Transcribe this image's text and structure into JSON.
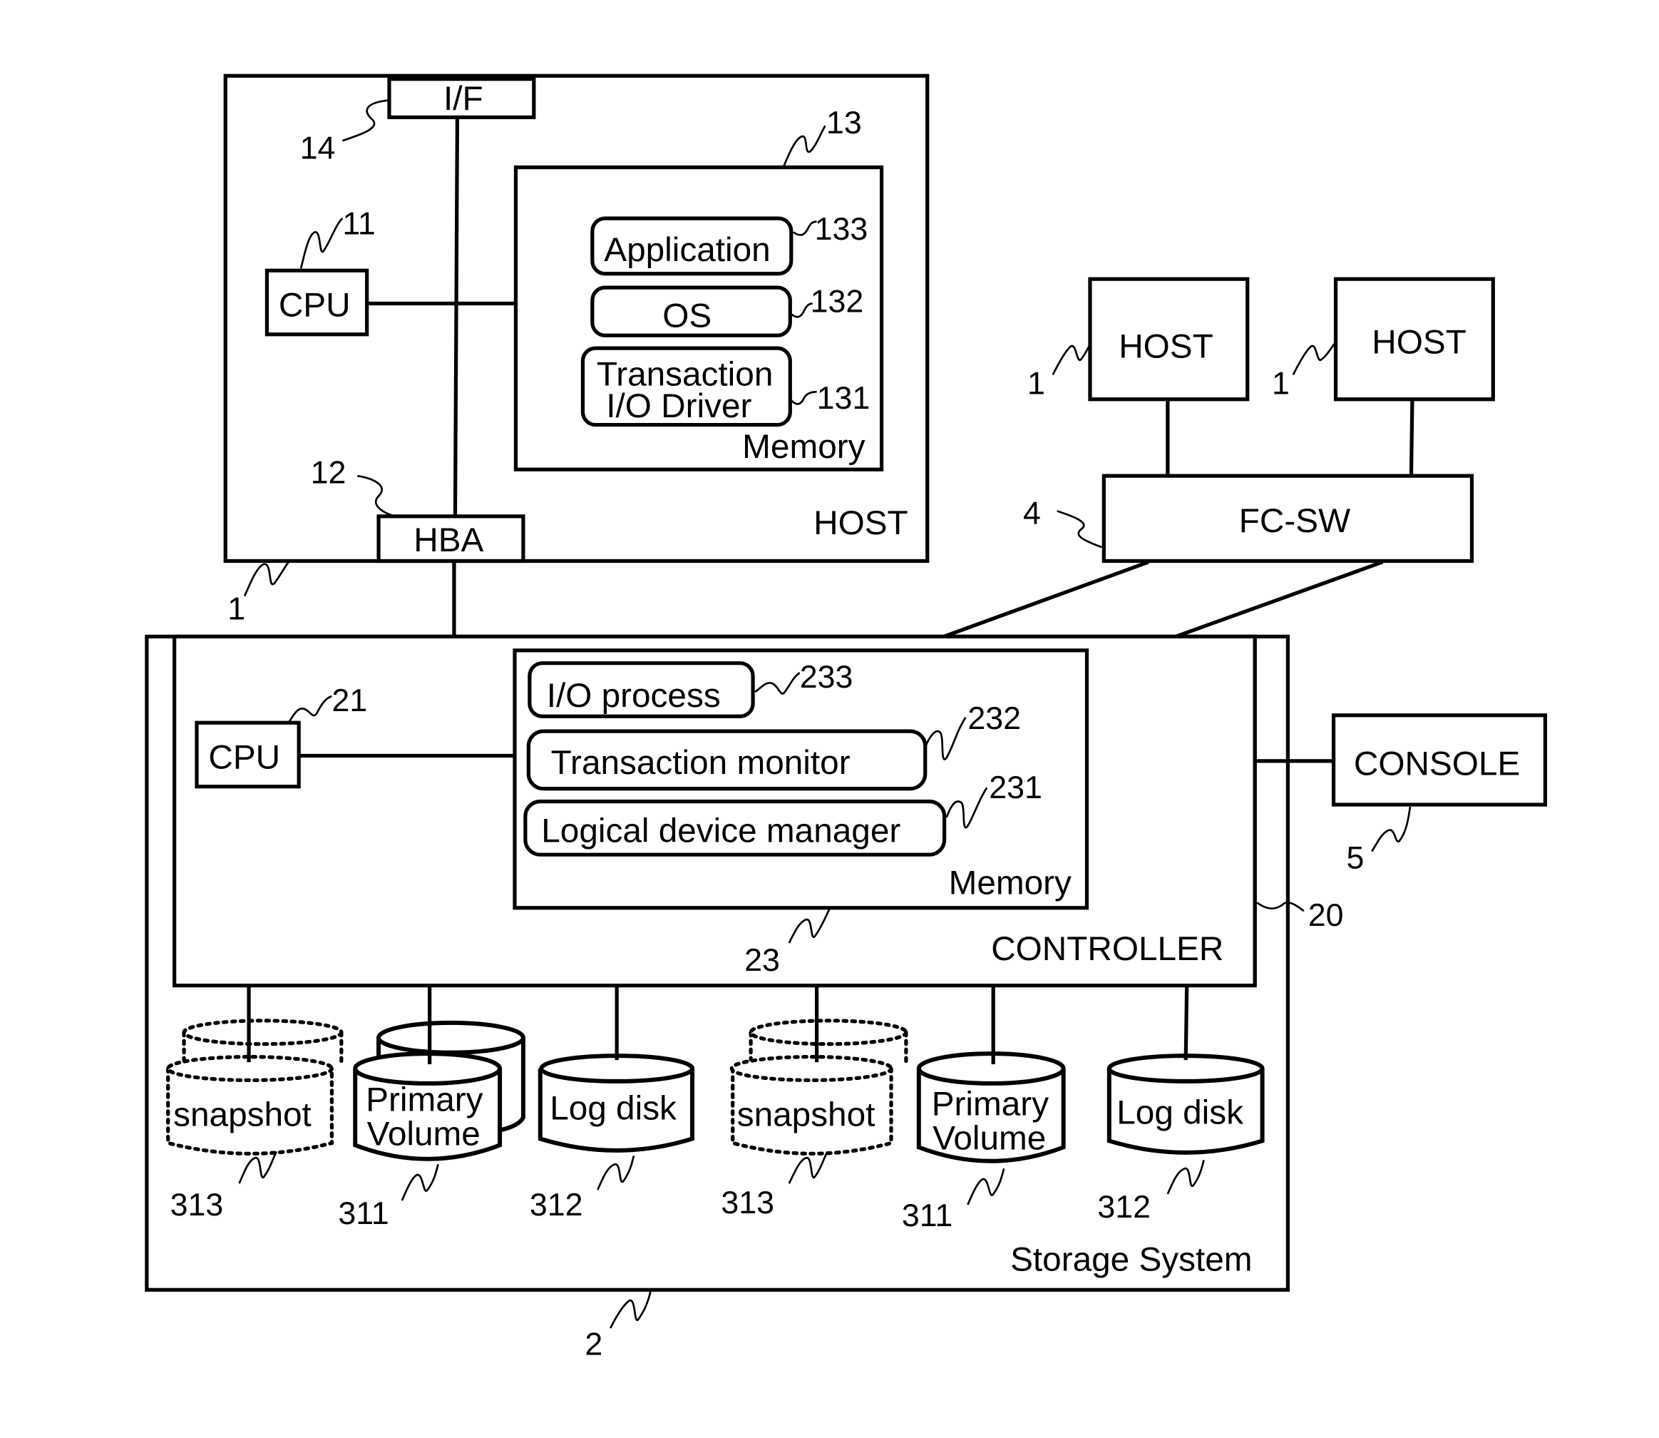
{
  "host_main": {
    "title": "HOST",
    "ref": "1",
    "interface": {
      "label": "I/F",
      "ref": "14"
    },
    "cpu": {
      "label": "CPU",
      "ref": "11"
    },
    "hba": {
      "label": "HBA",
      "ref": "12"
    },
    "memory": {
      "label": "Memory",
      "ref": "13",
      "modules": [
        {
          "label": "Application",
          "ref": "133"
        },
        {
          "label": "OS",
          "ref": "132"
        },
        {
          "label_line1": "Transaction",
          "label_line2": "I/O Driver",
          "ref": "131"
        }
      ]
    }
  },
  "other_hosts": [
    {
      "label": "HOST",
      "ref": "1"
    },
    {
      "label": "HOST",
      "ref": "1"
    }
  ],
  "fc_switch": {
    "label": "FC-SW",
    "ref": "4"
  },
  "console": {
    "label": "CONSOLE",
    "ref": "5"
  },
  "storage_system": {
    "label": "Storage System",
    "ref": "2",
    "controller": {
      "label": "CONTROLLER",
      "ref": "20",
      "cpu": {
        "label": "CPU",
        "ref": "21"
      },
      "memory": {
        "label": "Memory",
        "ref": "23",
        "modules": [
          {
            "label": "I/O process",
            "ref": "233"
          },
          {
            "label": "Transaction monitor",
            "ref": "232"
          },
          {
            "label": "Logical device manager",
            "ref": "231"
          }
        ]
      }
    },
    "disk_groups": [
      {
        "snapshot": {
          "label": "snapshot",
          "ref": "313"
        },
        "primary": {
          "label_line1": "Primary",
          "label_line2": "Volume",
          "ref": "311"
        },
        "log": {
          "label": "Log disk",
          "ref": "312"
        }
      },
      {
        "snapshot": {
          "label": "snapshot",
          "ref": "313"
        },
        "primary": {
          "label_line1": "Primary",
          "label_line2": "Volume",
          "ref": "311"
        },
        "log": {
          "label": "Log disk",
          "ref": "312"
        }
      }
    ]
  }
}
